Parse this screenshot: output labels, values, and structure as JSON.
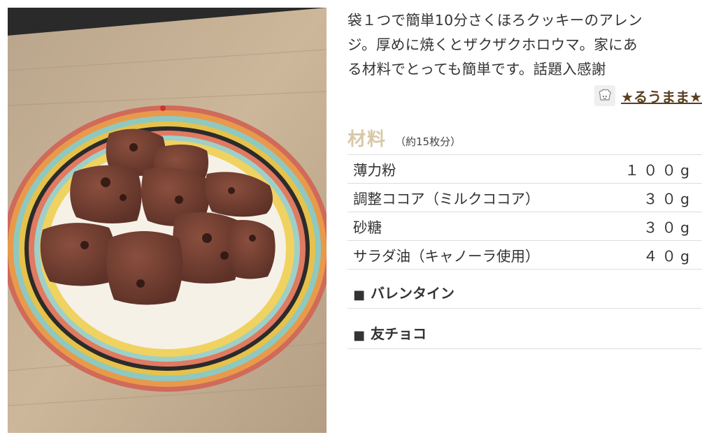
{
  "recipe": {
    "description": "袋１つで簡単10分さくほろクッキーのアレンジ。厚めに焼くとザクザクホロウマ。家にある材料でとっても簡単です。話題入感謝",
    "description_lines": [
      "袋１つで簡単10分さくほろクッキーのアレン",
      "ジ。厚めに焼くとザクザクホロウマ。家にあ",
      "る材料でとっても簡単です。話題入感謝"
    ],
    "author": "★るうまま★",
    "author_icon": "chef-avatar-icon"
  },
  "ingredients": {
    "title": "材料",
    "servings": "（約15枚分）",
    "items": [
      {
        "name": "薄力粉",
        "qty": "１００g"
      },
      {
        "name": "調整ココア（ミルクココア）",
        "qty": "３０g"
      },
      {
        "name": "砂糖",
        "qty": "３０g"
      },
      {
        "name": "サラダ油（キャノーラ使用）",
        "qty": "４０g"
      }
    ]
  },
  "groups": [
    {
      "marker": "■",
      "label": "バレンタイン"
    },
    {
      "marker": "■",
      "label": "友チョコ"
    }
  ],
  "colors": {
    "title_beige": "#d8c8a8",
    "author_brown": "#5a3e1f",
    "divider": "#dddddd"
  }
}
